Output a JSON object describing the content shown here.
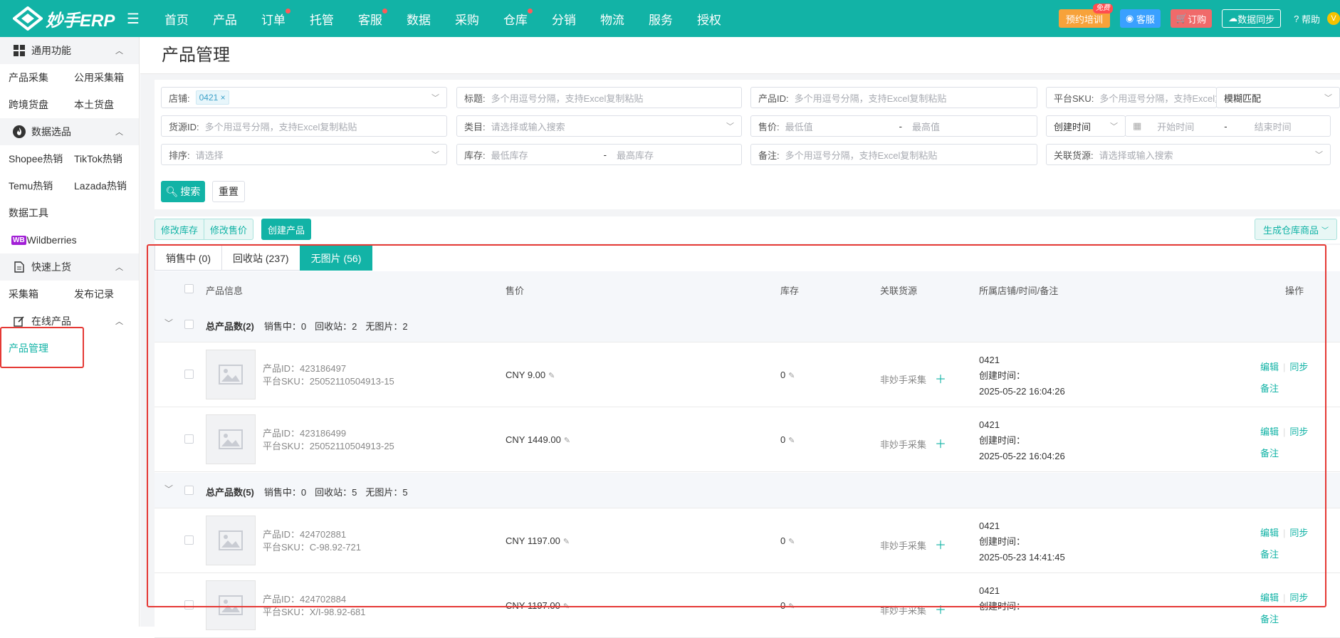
{
  "brand": {
    "name": "妙手ERP"
  },
  "topnav": {
    "items": [
      "首页",
      "产品",
      "订单",
      "托管",
      "客服",
      "数据",
      "采购",
      "仓库",
      "分销",
      "物流",
      "服务",
      "授权"
    ],
    "training": "预约培训",
    "free_badge": "免费",
    "kefu": "客服",
    "order": "订购",
    "sync": "数据同步",
    "help": "帮助",
    "avatar": "V"
  },
  "sidebar": {
    "common": "通用功能",
    "common_items": [
      "产品采集",
      "公用采集箱",
      "跨境货盘",
      "本土货盘"
    ],
    "data": "数据选品",
    "data_items": [
      "Shopee热销",
      "TikTok热销",
      "Temu热销",
      "Lazada热销"
    ],
    "data_tool": "数据工具",
    "wb_icon": "WB",
    "wb": "Wildberries",
    "quick": "快速上货",
    "quick_items": [
      "采集箱",
      "发布记录"
    ],
    "online": "在线产品",
    "product_mgmt": "产品管理"
  },
  "page": {
    "title": "产品管理"
  },
  "filters": {
    "shop_label": "店铺:",
    "shop_tag": "0421",
    "title_label": "标题:",
    "title_ph": "多个用逗号分隔，支持Excel复制粘贴",
    "pid_label": "产品ID:",
    "pid_ph": "多个用逗号分隔，支持Excel复制粘贴",
    "sku_label": "平台SKU:",
    "sku_ph": "多个用逗号分隔，支持Excel复制粘贴",
    "match": "模糊匹配",
    "src_label": "货源ID:",
    "src_ph": "多个用逗号分隔，支持Excel复制粘贴",
    "cat_label": "类目:",
    "cat_ph": "请选择或输入搜索",
    "price_label": "售价:",
    "price_min": "最低值",
    "price_max": "最高值",
    "time_type": "创建时间",
    "time_start": "开始时间",
    "time_end": "结束时间",
    "sort_label": "排序:",
    "sort_ph": "请选择",
    "stock_label": "库存:",
    "stock_min": "最低库存",
    "stock_max": "最高库存",
    "remark_label": "备注:",
    "remark_ph": "多个用逗号分隔，支持Excel复制粘贴",
    "linked_label": "关联货源:",
    "linked_ph": "请选择或输入搜索",
    "dash": "-",
    "search": "搜索",
    "reset": "重置"
  },
  "actions": {
    "edit_stock": "修改库存",
    "edit_price": "修改售价",
    "create": "创建产品",
    "gen_warehouse": "生成仓库商品"
  },
  "tabs": [
    {
      "label": "销售中 (0)",
      "active": false
    },
    {
      "label": "回收站 (237)",
      "active": false
    },
    {
      "label": "无图片 (56)",
      "active": true
    }
  ],
  "table": {
    "headers": {
      "info": "产品信息",
      "price": "售价",
      "stock": "库存",
      "source": "关联货源",
      "shop": "所属店铺/时间/备注",
      "ops": "操作"
    },
    "groups": [
      {
        "summary": "总产品数(2)",
        "selling": "销售中：0",
        "recycle": "回收站：2",
        "noimg": "无图片：2",
        "rows": [
          {
            "pid": "产品ID：423186497",
            "sku": "平台SKU：25052110504913-15",
            "price": "CNY 9.00",
            "stock": "0",
            "source": "非妙手采集",
            "shop": "0421",
            "created_label": "创建时间：",
            "created": "2025-05-22 16:04:26"
          },
          {
            "pid": "产品ID：423186499",
            "sku": "平台SKU：25052110504913-25",
            "price": "CNY 1449.00",
            "stock": "0",
            "source": "非妙手采集",
            "shop": "0421",
            "created_label": "创建时间：",
            "created": "2025-05-22 16:04:26"
          }
        ]
      },
      {
        "summary": "总产品数(5)",
        "selling": "销售中：0",
        "recycle": "回收站：5",
        "noimg": "无图片：5",
        "rows": [
          {
            "pid": "产品ID：424702881",
            "sku": "平台SKU：C-98.92-721",
            "price": "CNY 1197.00",
            "stock": "0",
            "source": "非妙手采集",
            "shop": "0421",
            "created_label": "创建时间：",
            "created": "2025-05-23 14:41:45"
          },
          {
            "pid": "产品ID：424702884",
            "sku": "平台SKU：X/I-98.92-681",
            "price": "CNY 1197.00",
            "stock": "0",
            "source": "非妙手采集",
            "shop": "0421",
            "created_label": "创建时间：",
            "created": ""
          }
        ]
      }
    ],
    "op_edit": "编辑",
    "op_sync": "同步",
    "op_remark": "备注"
  },
  "colors": {
    "primary": "#12b3a6",
    "highlight_box": "#e53935"
  }
}
